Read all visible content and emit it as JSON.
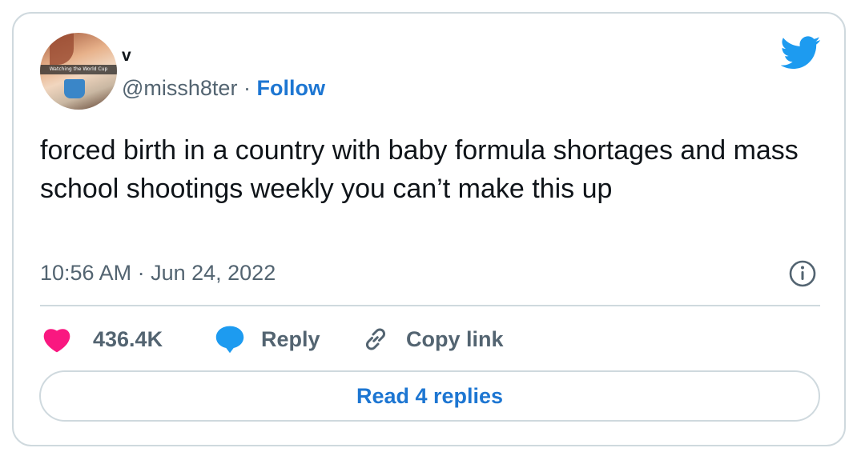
{
  "author": {
    "display_name": "v",
    "handle": "@missh8ter",
    "separator": "·",
    "follow_label": "Follow",
    "avatar_caption": "Watching the World Cup"
  },
  "tweet": {
    "text": "forced birth in a country with baby formula shortages and mass school shootings weekly you can’t make this up",
    "timestamp": "10:56 AM · Jun 24, 2022"
  },
  "actions": {
    "like_count": "436.4K",
    "reply_label": "Reply",
    "copy_link_label": "Copy link"
  },
  "read_replies_label": "Read 4 replies",
  "colors": {
    "brand_blue": "#1d9bf0",
    "link_blue": "#1d76d2",
    "heart_pink": "#f91880",
    "text_secondary": "#536471",
    "border": "#cfd9de"
  },
  "icons": [
    "twitter-bird-icon",
    "info-icon",
    "heart-icon",
    "reply-bubble-icon",
    "link-icon"
  ]
}
